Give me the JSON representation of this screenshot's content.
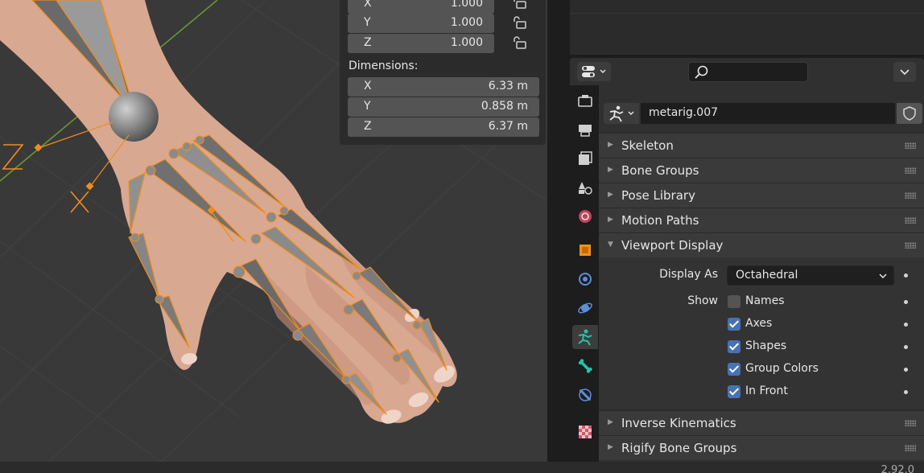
{
  "viewport": {
    "axis_labels": [
      "Z",
      "X"
    ],
    "item_panel": {
      "scale_rows": [
        {
          "axis": "X",
          "value": "1.000"
        },
        {
          "axis": "Y",
          "value": "1.000"
        },
        {
          "axis": "Z",
          "value": "1.000"
        }
      ],
      "dimensions_label": "Dimensions:",
      "dimension_rows": [
        {
          "axis": "X",
          "value": "6.33 m"
        },
        {
          "axis": "Y",
          "value": "0.858 m"
        },
        {
          "axis": "Z",
          "value": "6.37 m"
        }
      ]
    }
  },
  "properties": {
    "header": {
      "editor_icon": "properties-editor-icon",
      "search_placeholder": ""
    },
    "tabs": [
      {
        "icon": "tool-icon"
      },
      {
        "icon": "render-icon"
      },
      {
        "icon": "output-icon"
      },
      {
        "icon": "view-layer-icon"
      },
      {
        "icon": "scene-icon"
      },
      {
        "icon": "world-icon"
      },
      {
        "icon": "object-icon"
      },
      {
        "icon": "modifiers-icon"
      },
      {
        "icon": "physics-icon"
      },
      {
        "icon": "armature-data-icon",
        "active": true
      },
      {
        "icon": "bone-icon"
      },
      {
        "icon": "bone-constraints-icon"
      },
      {
        "icon": "texture-icon"
      }
    ],
    "object_name": "metarig.007",
    "panels": [
      {
        "title": "Skeleton",
        "expanded": false
      },
      {
        "title": "Bone Groups",
        "expanded": false
      },
      {
        "title": "Pose Library",
        "expanded": false
      },
      {
        "title": "Motion Paths",
        "expanded": false
      },
      {
        "title": "Viewport Display",
        "expanded": true
      },
      {
        "title": "Inverse Kinematics",
        "expanded": false
      },
      {
        "title": "Rigify Bone Groups",
        "expanded": false
      }
    ],
    "viewport_display": {
      "display_as_label": "Display As",
      "display_as_value": "Octahedral",
      "show_label": "Show",
      "options": [
        {
          "label": "Names",
          "checked": false
        },
        {
          "label": "Axes",
          "checked": true
        },
        {
          "label": "Shapes",
          "checked": true
        },
        {
          "label": "Group Colors",
          "checked": true
        },
        {
          "label": "In Front",
          "checked": true
        }
      ]
    }
  },
  "status_bar": {
    "version": "2.92.0"
  },
  "colors": {
    "accent_checkbox": "#4772b3",
    "bone_outline": "#f08c1e",
    "active_tab_icon": "#27c3a8",
    "grid_axis_green": "#6b9c2f"
  }
}
